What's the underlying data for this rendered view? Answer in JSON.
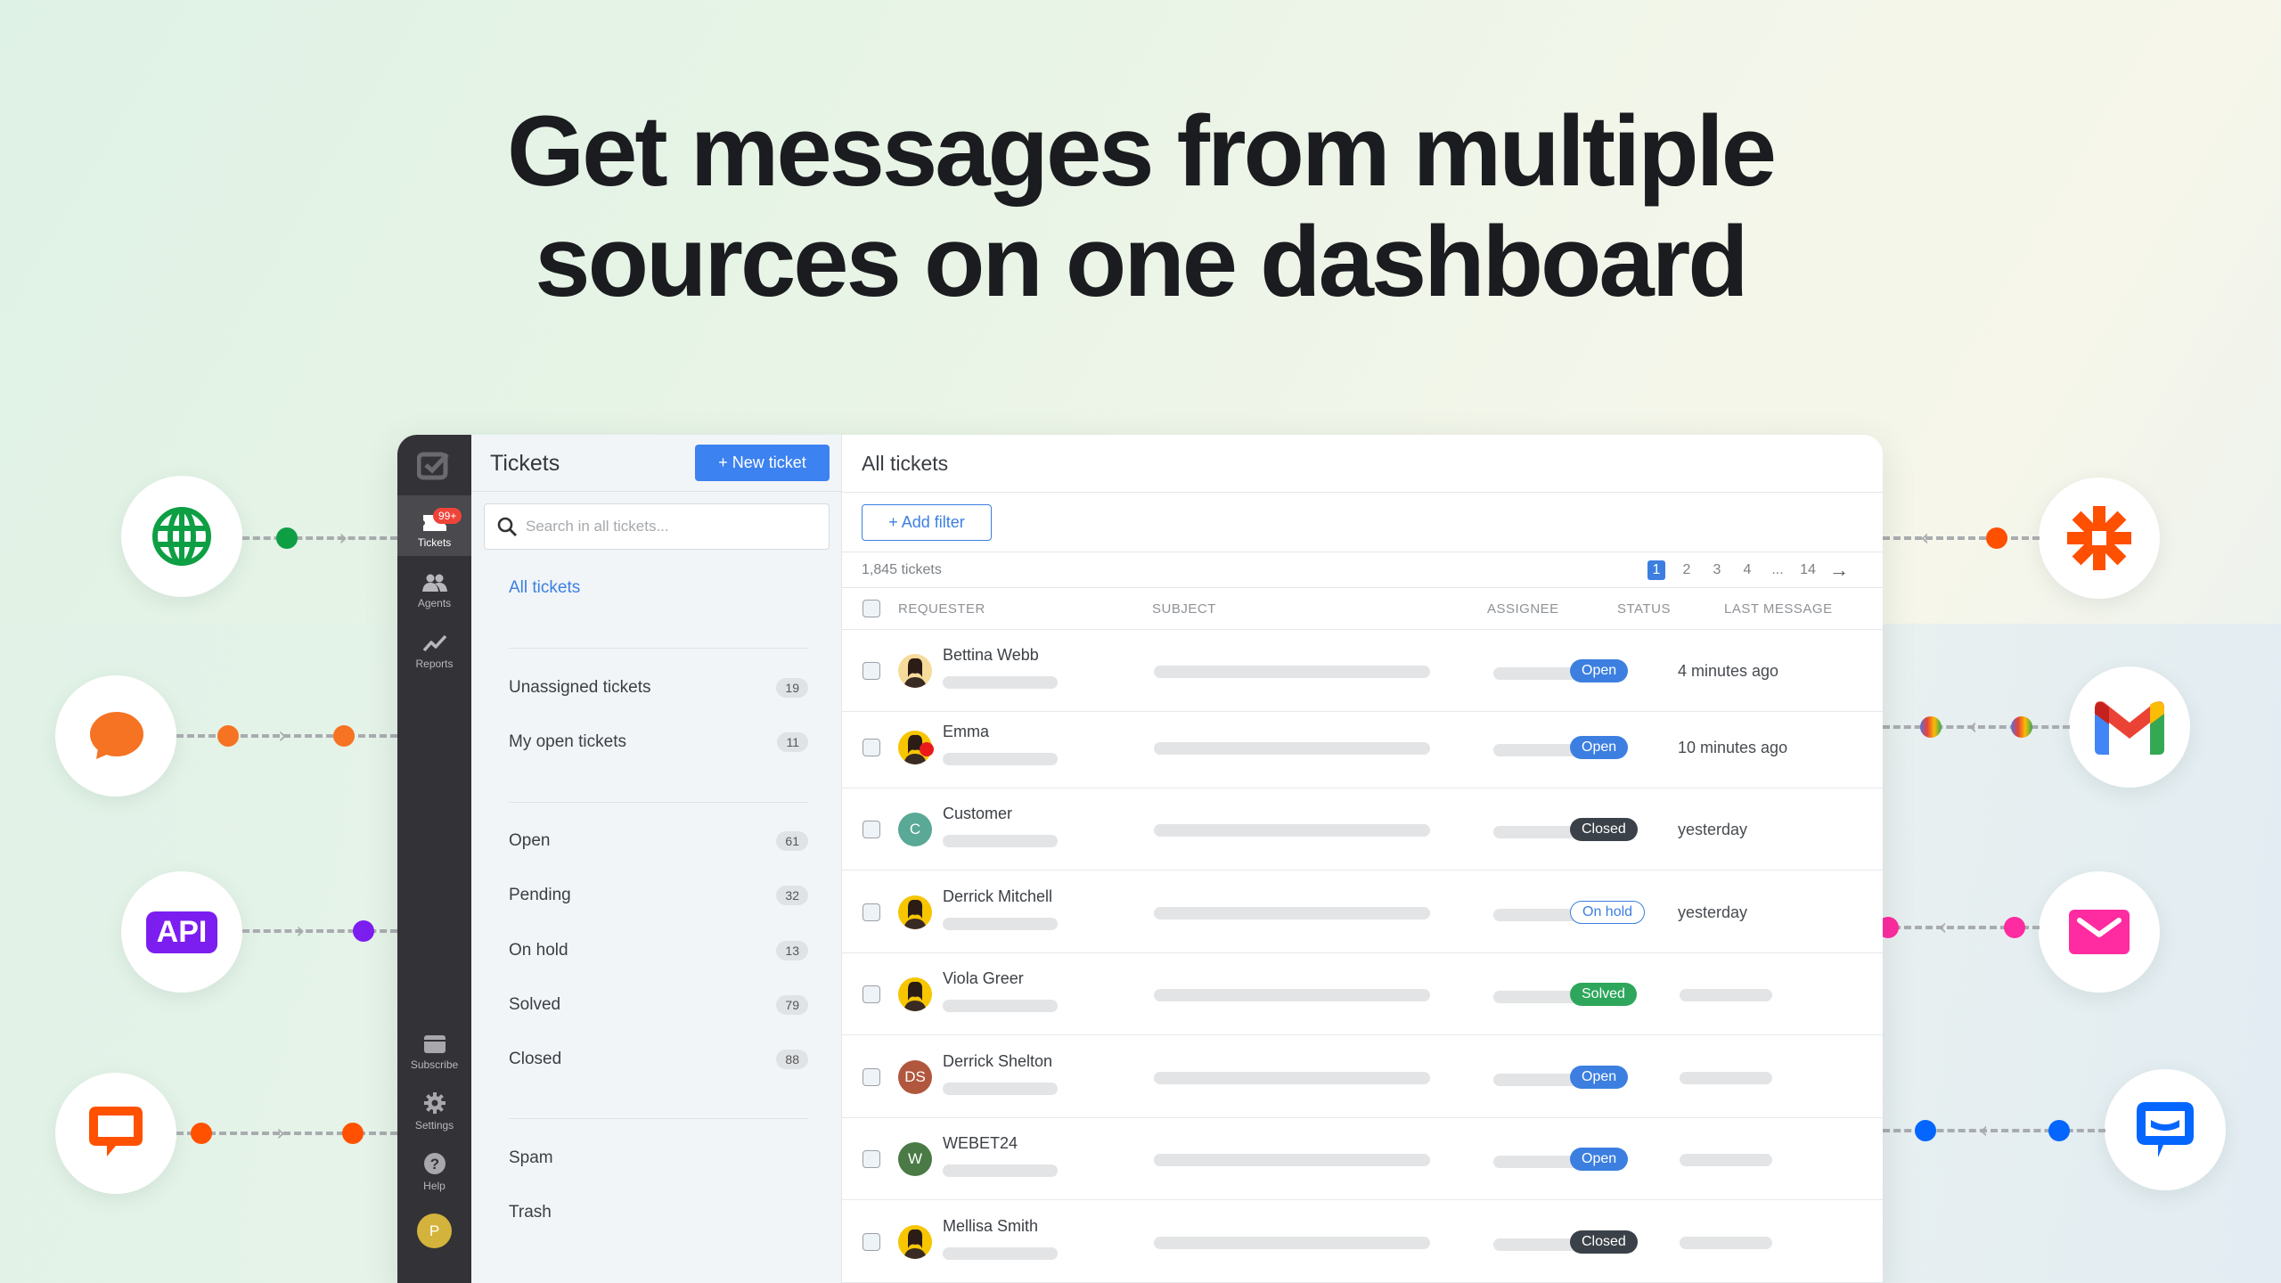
{
  "headline": {
    "line1": "Get messages from multiple",
    "line2": "sources on one dashboard"
  },
  "sources": {
    "left": [
      {
        "name": "website",
        "icon": "globe-icon",
        "color": "#0e9f45"
      },
      {
        "name": "chat-bubble",
        "icon": "chat-bubble-icon",
        "color": "#f57322"
      },
      {
        "name": "api",
        "icon": "api-icon",
        "label": "API",
        "color": "#7c1ef0"
      },
      {
        "name": "livechat",
        "icon": "livechat-icon",
        "color": "#ff5100"
      }
    ],
    "right": [
      {
        "name": "zapier",
        "icon": "zapier-icon",
        "color": "#ff4f00"
      },
      {
        "name": "gmail",
        "icon": "gmail-icon"
      },
      {
        "name": "email",
        "icon": "envelope-icon",
        "color": "#ff2ba0"
      },
      {
        "name": "chatbot",
        "icon": "chatbot-icon",
        "color": "#0566ff"
      }
    ]
  },
  "sidebar": {
    "items": [
      {
        "label": "Tickets",
        "icon": "ticket-icon",
        "badge": "99+",
        "active": true
      },
      {
        "label": "Agents",
        "icon": "agents-icon"
      },
      {
        "label": "Reports",
        "icon": "reports-icon"
      }
    ],
    "bottom_items": [
      {
        "label": "Subscribe",
        "icon": "card-icon"
      },
      {
        "label": "Settings",
        "icon": "gear-icon"
      },
      {
        "label": "Help",
        "icon": "help-icon"
      }
    ],
    "user_initial": "P",
    "user_color": "#d4b33c"
  },
  "left_panel": {
    "title": "Tickets",
    "new_ticket_label": "+ New ticket",
    "search_placeholder": "Search in all tickets...",
    "all_tickets": "All tickets",
    "group1": [
      {
        "label": "Unassigned tickets",
        "count": "19"
      },
      {
        "label": "My open tickets",
        "count": "11"
      }
    ],
    "group2": [
      {
        "label": "Open",
        "count": "61"
      },
      {
        "label": "Pending",
        "count": "32"
      },
      {
        "label": "On hold",
        "count": "13"
      },
      {
        "label": "Solved",
        "count": "79"
      },
      {
        "label": "Closed",
        "count": "88"
      }
    ],
    "group3": [
      {
        "label": "Spam"
      },
      {
        "label": "Trash"
      }
    ]
  },
  "main": {
    "title": "All tickets",
    "add_filter_label": "+ Add filter",
    "ticket_count": "1,845 tickets",
    "pagination": {
      "pages": [
        "1",
        "2",
        "3",
        "4",
        "...",
        "14"
      ],
      "current": "1",
      "next": "→"
    },
    "columns": [
      "REQUESTER",
      "SUBJECT",
      "ASSIGNEE",
      "STATUS",
      "LAST MESSAGE"
    ],
    "rows": [
      {
        "requester": "Bettina Webb",
        "avatar_type": "photo",
        "avatar_bg": "#f6dc9a",
        "status": "Open",
        "status_kind": "open",
        "last_message": "4 minutes ago"
      },
      {
        "requester": "Emma",
        "avatar_type": "photo",
        "avatar_bg": "#f7c600",
        "status": "Open",
        "status_kind": "open",
        "last_message": "10 minutes ago"
      },
      {
        "requester": "Customer",
        "avatar_type": "initials",
        "initials": "C",
        "avatar_bg": "#5aa896",
        "status": "Closed",
        "status_kind": "closed",
        "last_message": "yesterday"
      },
      {
        "requester": "Derrick Mitchell",
        "avatar_type": "photo",
        "avatar_bg": "#f7c600",
        "status": "On hold",
        "status_kind": "hold",
        "last_message": "yesterday"
      },
      {
        "requester": "Viola Greer",
        "avatar_type": "photo",
        "avatar_bg": "#f7c600",
        "status": "Solved",
        "status_kind": "solved",
        "last_message": ""
      },
      {
        "requester": "Derrick Shelton",
        "avatar_type": "initials",
        "initials": "DS",
        "avatar_bg": "#b0573e",
        "status": "Open",
        "status_kind": "open",
        "last_message": ""
      },
      {
        "requester": "WEBET24",
        "avatar_type": "initials",
        "initials": "W",
        "avatar_bg": "#4a7a45",
        "status": "Open",
        "status_kind": "open",
        "last_message": ""
      },
      {
        "requester": "Mellisa Smith",
        "avatar_type": "photo",
        "avatar_bg": "#f7c600",
        "status": "Closed",
        "status_kind": "closed",
        "last_message": ""
      }
    ]
  }
}
